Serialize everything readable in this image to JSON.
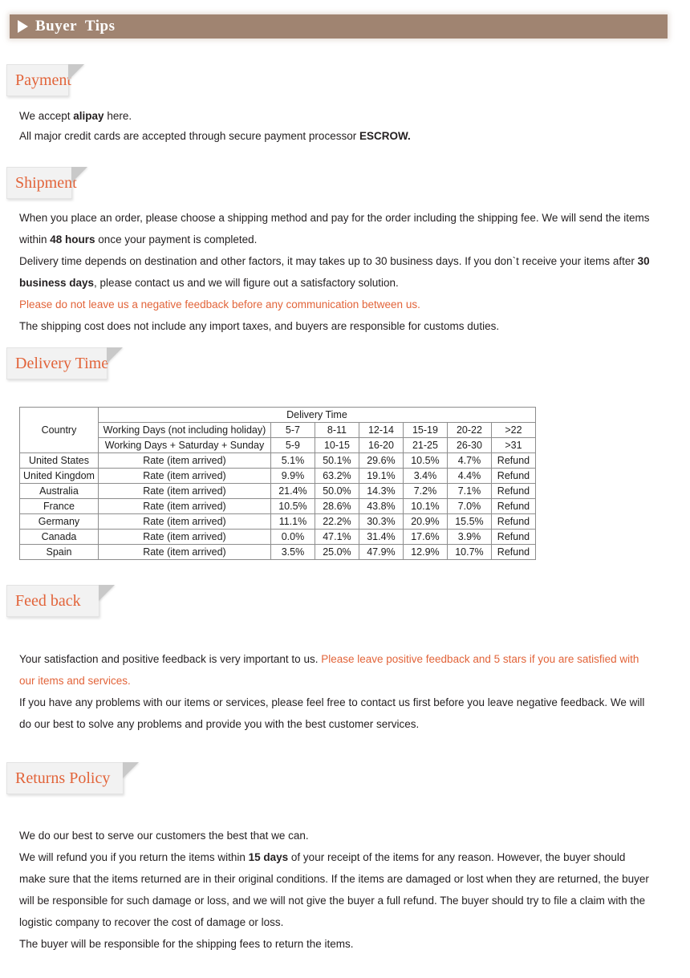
{
  "banner": {
    "arrow_icon": "play-triangle-icon",
    "title": "Buyer  Tips"
  },
  "sections": {
    "payment": {
      "badge": "Payment",
      "lines": [
        {
          "parts": [
            {
              "text": "We accept ",
              "style": "normal"
            },
            {
              "text": "alipay",
              "style": "bold"
            },
            {
              "text": " here.",
              "style": "normal"
            }
          ]
        },
        {
          "parts": [
            {
              "text": "All major credit cards are accepted through secure payment processor ",
              "style": "normal"
            },
            {
              "text": "ESCROW.",
              "style": "bold"
            }
          ]
        }
      ]
    },
    "shipment": {
      "badge": "Shipment",
      "lines": [
        {
          "parts": [
            {
              "text": "When you place an order, please choose a shipping method and pay for the order including the shipping fee. We will send the items within ",
              "style": "normal"
            },
            {
              "text": "48 hours",
              "style": "bold"
            },
            {
              "text": " once your payment is completed.",
              "style": "normal"
            }
          ]
        },
        {
          "parts": [
            {
              "text": "Delivery time depends on destination and other factors, it may takes up to 30 business days. If you don`t receive your items after ",
              "style": "normal"
            },
            {
              "text": "30 business days",
              "style": "bold"
            },
            {
              "text": ", please contact us and we will figure out a satisfactory solution.",
              "style": "normal"
            }
          ]
        },
        {
          "parts": [
            {
              "text": " Please do not leave us a negative feedback before any communication between us.",
              "style": "highlight"
            }
          ]
        },
        {
          "parts": [
            {
              "text": "The shipping cost does not include any import taxes, and buyers are responsible for customs duties.",
              "style": "normal"
            }
          ]
        }
      ]
    },
    "delivery_time": {
      "badge": "Delivery Time"
    },
    "feedback": {
      "badge": "Feed back",
      "lines": [
        {
          "parts": [
            {
              "text": "Your satisfaction and positive feedback is very important to us. ",
              "style": "normal"
            },
            {
              "text": "Please leave positive feedback and 5 stars if you are satisfied with our items and services.",
              "style": "highlight"
            }
          ]
        },
        {
          "parts": [
            {
              "text": "If you have any problems with our items or services, please feel free to contact us first before you leave negative feedback. We will do our best to solve any problems and provide you with the best customer services.",
              "style": "normal"
            }
          ]
        }
      ]
    },
    "returns_policy": {
      "badge": "Returns Policy",
      "lines": [
        {
          "parts": [
            {
              "text": "We do our best to serve our customers the best that we can.",
              "style": "normal"
            }
          ]
        },
        {
          "parts": [
            {
              "text": "We will refund you if you return the items within ",
              "style": "normal"
            },
            {
              "text": "15 days",
              "style": "bold"
            },
            {
              "text": " of your receipt of the items for any reason. However, the buyer should make sure that the items returned are in their original conditions. If the items are damaged or lost when they are returned, the buyer will be responsible for such damage or loss, and we will not give the buyer a full refund. The buyer should try to file a claim with the logistic company to recover the cost of damage or loss.",
              "style": "normal"
            }
          ]
        },
        {
          "parts": [
            {
              "text": "The buyer will be responsible for the shipping fees to return the items.",
              "style": "normal"
            }
          ]
        }
      ]
    }
  },
  "delivery_table": {
    "country_header": "Country",
    "group_header": "Delivery Time",
    "row_working_days_label": "Working Days (not including holiday)",
    "row_working_days_values": [
      "5-7",
      "8-11",
      "12-14",
      "15-19",
      "20-22",
      ">22"
    ],
    "row_with_weekend_label": "Working Days + Saturday + Sunday",
    "row_with_weekend_values": [
      "5-9",
      "10-15",
      "16-20",
      "21-25",
      "26-30",
      ">31"
    ],
    "rate_label": "Rate (item arrived)",
    "rows": [
      {
        "country": "United States",
        "values": [
          "5.1%",
          "50.1%",
          "29.6%",
          "10.5%",
          "4.7%",
          "Refund"
        ]
      },
      {
        "country": "United Kingdom",
        "values": [
          "9.9%",
          "63.2%",
          "19.1%",
          "3.4%",
          "4.4%",
          "Refund"
        ]
      },
      {
        "country": "Australia",
        "values": [
          "21.4%",
          "50.0%",
          "14.3%",
          "7.2%",
          "7.1%",
          "Refund"
        ]
      },
      {
        "country": "France",
        "values": [
          "10.5%",
          "28.6%",
          "43.8%",
          "10.1%",
          "7.0%",
          "Refund"
        ]
      },
      {
        "country": "Germany",
        "values": [
          "11.1%",
          "22.2%",
          "30.3%",
          "20.9%",
          "15.5%",
          "Refund"
        ]
      },
      {
        "country": "Canada",
        "values": [
          "0.0%",
          "47.1%",
          "31.4%",
          "17.6%",
          "3.9%",
          "Refund"
        ]
      },
      {
        "country": "Spain",
        "values": [
          "3.5%",
          "25.0%",
          "47.9%",
          "12.9%",
          "10.7%",
          "Refund"
        ]
      }
    ]
  },
  "colors": {
    "banner_bg": "#a08471",
    "accent": "#e2643a",
    "badge_bg": "#f2f2f2",
    "text": "#231f20",
    "table_border": "#8d8d8d"
  }
}
